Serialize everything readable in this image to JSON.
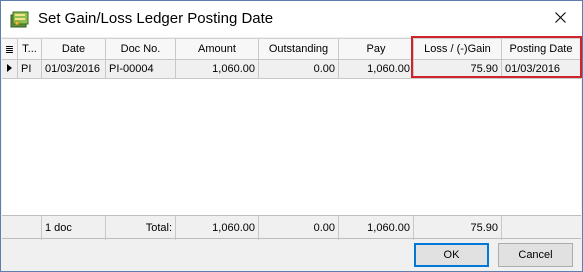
{
  "window": {
    "title": "Set Gain/Loss Ledger Posting Date",
    "icon": "ledger-app-icon",
    "close_icon": "close-icon"
  },
  "grid": {
    "columns": {
      "menu": "≣",
      "type": "T...",
      "date": "Date",
      "doc_no": "Doc No.",
      "amount": "Amount",
      "outstanding": "Outstanding",
      "pay": "Pay",
      "loss_gain": "Loss / (-)Gain",
      "posting_date": "Posting Date"
    },
    "rows": [
      {
        "type": "PI",
        "date": "01/03/2016",
        "doc_no": "PI-00004",
        "amount": "1,060.00",
        "outstanding": "0.00",
        "pay": "1,060.00",
        "loss_gain": "75.90",
        "posting_date": "01/03/2016"
      }
    ]
  },
  "footer": {
    "doc_count": "1 doc",
    "total_label": "Total:",
    "amount_total": "1,060.00",
    "outstanding_total": "0.00",
    "pay_total": "1,060.00",
    "loss_gain_total": "75.90"
  },
  "buttons": {
    "ok": "OK",
    "cancel": "Cancel"
  },
  "colors": {
    "highlight": "#d0242c",
    "default_button_border": "#0078d7"
  }
}
